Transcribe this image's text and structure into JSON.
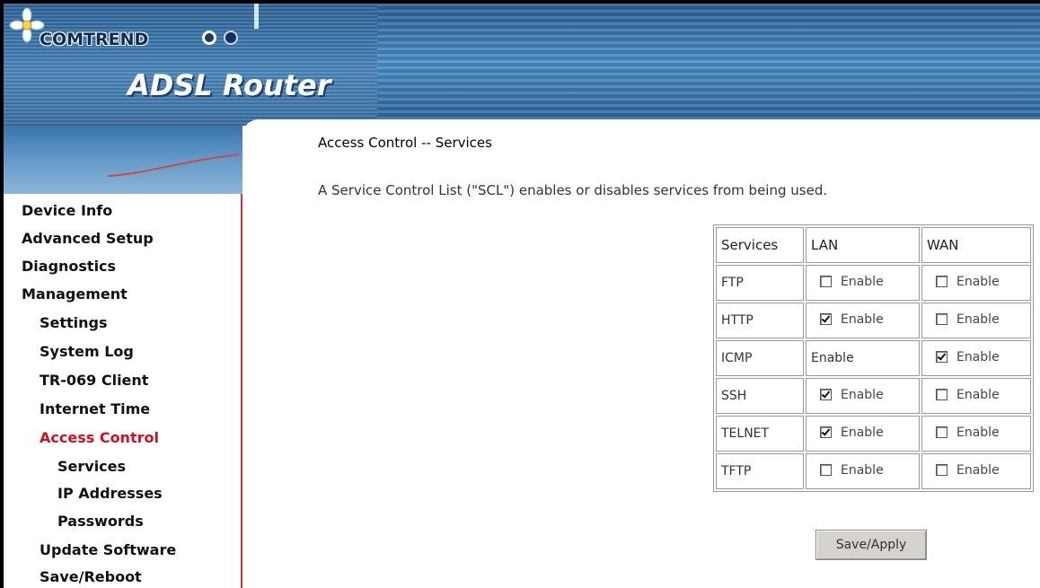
{
  "header": {
    "brand": "COMTREND",
    "product": "ADSL Router"
  },
  "sidebar": {
    "items": [
      {
        "label": "Device Info",
        "level": 1,
        "active": false
      },
      {
        "label": "Advanced Setup",
        "level": 1,
        "active": false
      },
      {
        "label": "Diagnostics",
        "level": 1,
        "active": false
      },
      {
        "label": "Management",
        "level": 1,
        "active": false
      },
      {
        "label": "Settings",
        "level": 2,
        "active": false
      },
      {
        "label": "System Log",
        "level": 2,
        "active": false
      },
      {
        "label": "TR-069 Client",
        "level": 2,
        "active": false
      },
      {
        "label": "Internet Time",
        "level": 2,
        "active": false
      },
      {
        "label": "Access Control",
        "level": 2,
        "active": true
      },
      {
        "label": "Services",
        "level": 3,
        "active": false
      },
      {
        "label": "IP Addresses",
        "level": 3,
        "active": false
      },
      {
        "label": "Passwords",
        "level": 3,
        "active": false
      },
      {
        "label": "Update Software",
        "level": 2,
        "active": false
      },
      {
        "label": "Save/Reboot",
        "level": 2,
        "active": false
      }
    ],
    "active_color": "#d01020"
  },
  "main": {
    "title": "Access Control -- Services",
    "description": "A Service Control List (\"SCL\") enables or disables services from being used.",
    "table": {
      "headers": [
        "Services",
        "LAN",
        "WAN"
      ],
      "enable_label": "Enable",
      "rows": [
        {
          "service": "FTP",
          "lan": {
            "has_checkbox": true,
            "checked": false
          },
          "wan": {
            "has_checkbox": true,
            "checked": false
          }
        },
        {
          "service": "HTTP",
          "lan": {
            "has_checkbox": true,
            "checked": true
          },
          "wan": {
            "has_checkbox": true,
            "checked": false
          }
        },
        {
          "service": "ICMP",
          "lan": {
            "has_checkbox": false,
            "checked": false
          },
          "wan": {
            "has_checkbox": true,
            "checked": true
          }
        },
        {
          "service": "SSH",
          "lan": {
            "has_checkbox": true,
            "checked": true
          },
          "wan": {
            "has_checkbox": true,
            "checked": false
          }
        },
        {
          "service": "TELNET",
          "lan": {
            "has_checkbox": true,
            "checked": true
          },
          "wan": {
            "has_checkbox": true,
            "checked": false
          }
        },
        {
          "service": "TFTP",
          "lan": {
            "has_checkbox": true,
            "checked": false
          },
          "wan": {
            "has_checkbox": true,
            "checked": false
          }
        }
      ]
    },
    "save_label": "Save/Apply"
  }
}
